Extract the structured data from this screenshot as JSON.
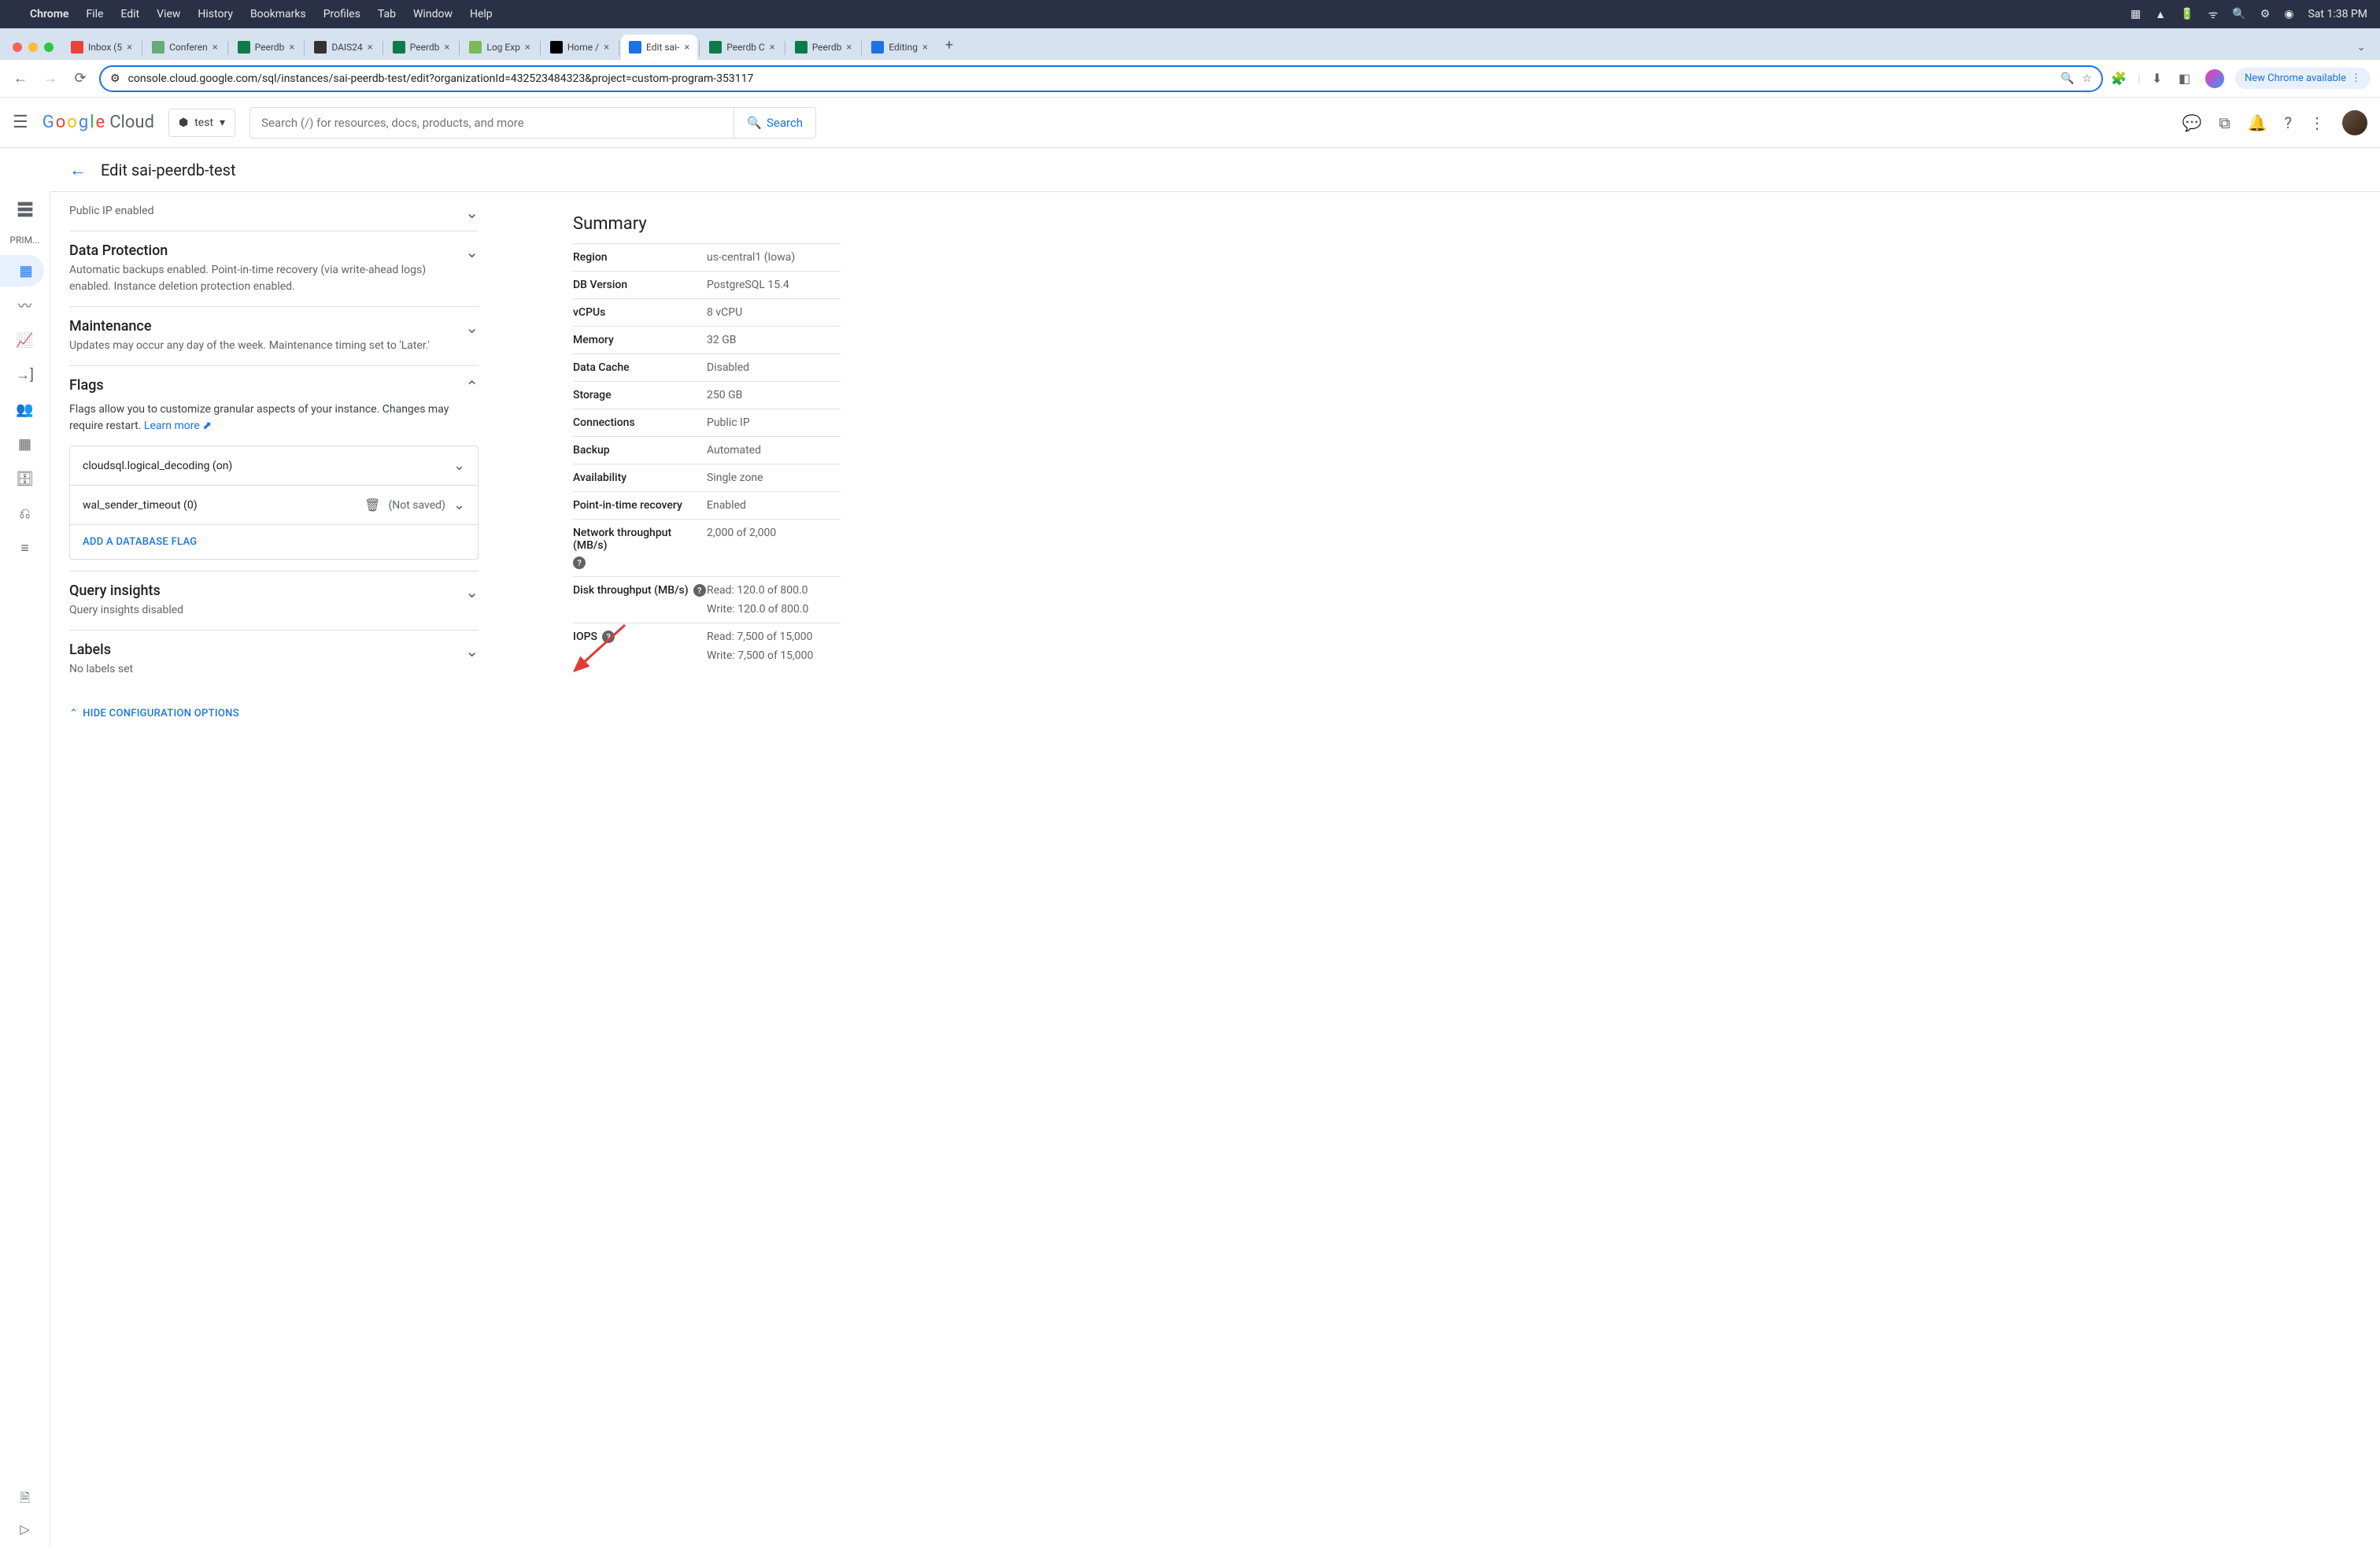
{
  "mac_menu": {
    "app": "Chrome",
    "items": [
      "File",
      "Edit",
      "View",
      "History",
      "Bookmarks",
      "Profiles",
      "Tab",
      "Window",
      "Help"
    ],
    "clock": "Sat 1:38 PM"
  },
  "tabs": [
    {
      "label": "Inbox (5",
      "favicon": "#ea4335"
    },
    {
      "label": "Conferen",
      "favicon": "#6a7"
    },
    {
      "label": "Peerdb",
      "favicon": "#0a7d46"
    },
    {
      "label": "DAIS24",
      "favicon": "#333"
    },
    {
      "label": "Peerdb",
      "favicon": "#0a7d46"
    },
    {
      "label": "Log Exp",
      "favicon": "#7b5"
    },
    {
      "label": "Home /",
      "favicon": "#000"
    },
    {
      "label": "Edit sai-",
      "favicon": "#1a73e8",
      "active": true
    },
    {
      "label": "Peerdb C",
      "favicon": "#0a7d46"
    },
    {
      "label": "Peerdb",
      "favicon": "#0a7d46"
    },
    {
      "label": "Editing",
      "favicon": "#1a73e8"
    }
  ],
  "url": "console.cloud.google.com/sql/instances/sai-peerdb-test/edit?organizationId=432523484323&project=custom-program-353117",
  "new_chrome": "New Chrome available",
  "gcp": {
    "logo_cloud": "Cloud",
    "project": "test",
    "search_placeholder": "Search (/) for resources, docs, products, and more",
    "search_button": "Search"
  },
  "side_rail_label": "PRIM...",
  "page_title": "Edit sai-peerdb-test",
  "sections": {
    "public_ip": {
      "desc": "Public IP enabled"
    },
    "data_protection": {
      "title": "Data Protection",
      "desc": "Automatic backups enabled. Point-in-time recovery (via write-ahead logs) enabled. Instance deletion protection enabled."
    },
    "maintenance": {
      "title": "Maintenance",
      "desc": "Updates may occur any day of the week. Maintenance timing set to 'Later.'"
    },
    "flags": {
      "title": "Flags",
      "desc": "Flags allow you to customize granular aspects of your instance. Changes may require restart. ",
      "learn_more": "Learn more",
      "rows": [
        {
          "name": "cloudsql.logical_decoding (on)"
        },
        {
          "name": "wal_sender_timeout (0)",
          "not_saved": "(Not saved)",
          "deletable": true
        }
      ],
      "add": "ADD A DATABASE FLAG"
    },
    "query_insights": {
      "title": "Query insights",
      "desc": "Query insights disabled"
    },
    "labels": {
      "title": "Labels",
      "desc": "No labels set"
    }
  },
  "hide_config": "HIDE CONFIGURATION OPTIONS",
  "summary": {
    "title": "Summary",
    "rows": [
      {
        "key": "Region",
        "val": "us-central1 (Iowa)"
      },
      {
        "key": "DB Version",
        "val": "PostgreSQL 15.4"
      },
      {
        "key": "vCPUs",
        "val": "8 vCPU"
      },
      {
        "key": "Memory",
        "val": "32 GB"
      },
      {
        "key": "Data Cache",
        "val": "Disabled"
      },
      {
        "key": "Storage",
        "val": "250 GB"
      },
      {
        "key": "Connections",
        "val": "Public IP"
      },
      {
        "key": "Backup",
        "val": "Automated"
      },
      {
        "key": "Availability",
        "val": "Single zone"
      },
      {
        "key": "Point-in-time recovery",
        "val": "Enabled"
      },
      {
        "key": "Network throughput (MB/s)",
        "val": "2,000 of 2,000",
        "help": true
      },
      {
        "key": "Disk throughput (MB/s)",
        "val": "Read: 120.0 of 800.0",
        "val2": "Write: 120.0 of 800.0",
        "help": true
      },
      {
        "key": "IOPS",
        "val": "Read: 7,500 of 15,000",
        "val2": "Write: 7,500 of 15,000",
        "help": true
      }
    ]
  }
}
